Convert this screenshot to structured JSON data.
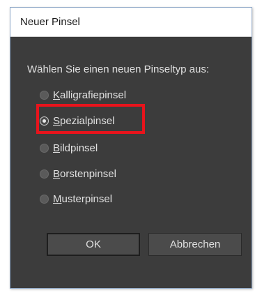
{
  "dialog": {
    "title": "Neuer Pinsel",
    "prompt": "Wählen Sie einen neuen Pinseltyp aus:",
    "options": [
      {
        "mnemonic": "K",
        "rest": "alligrafiepinsel",
        "checked": false
      },
      {
        "mnemonic": "S",
        "rest": "pezialpinsel",
        "checked": true
      },
      {
        "mnemonic": "B",
        "rest": "ildpinsel",
        "checked": false
      },
      {
        "mnemonic": "B",
        "rest": "orstenpinsel",
        "checked": false
      },
      {
        "mnemonic": "M",
        "rest": "usterpinsel",
        "checked": false
      }
    ],
    "ok_label": "OK",
    "cancel_label": "Abbrechen"
  },
  "colors": {
    "dialog_bg": "#3c3c3c",
    "highlight": "#e8141c",
    "text": "#e0e0e0"
  }
}
